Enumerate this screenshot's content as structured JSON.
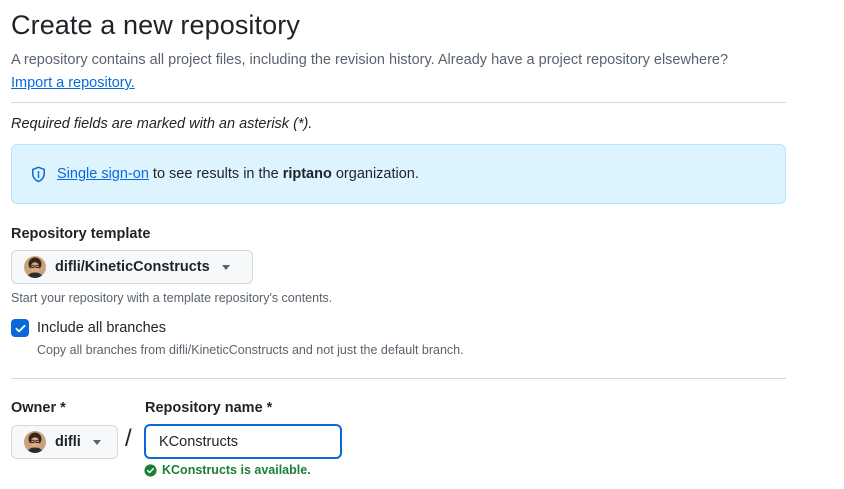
{
  "header": {
    "title": "Create a new repository",
    "description": "A repository contains all project files, including the revision history. Already have a project repository elsewhere? ",
    "import_link": "Import a repository."
  },
  "required_note": "Required fields are marked with an asterisk (*).",
  "sso_notice": {
    "link": "Single sign-on",
    "text_before_org": " to see results in the ",
    "org": "riptano",
    "text_after_org": " organization."
  },
  "template": {
    "label": "Repository template",
    "selected": "difli/KineticConstructs",
    "hint": "Start your repository with a template repository's contents."
  },
  "include_branches": {
    "label": "Include all branches",
    "checked": true,
    "hint": "Copy all branches from difli/KineticConstructs and not just the default branch."
  },
  "owner": {
    "label": "Owner *",
    "selected": "difli"
  },
  "separator": "/",
  "repo_name": {
    "label": "Repository name *",
    "value": "KConstructs",
    "status": "KConstructs is available."
  },
  "colors": {
    "accent": "#0969da",
    "success": "#1a7f37",
    "flash_bg": "#ddf4ff"
  }
}
